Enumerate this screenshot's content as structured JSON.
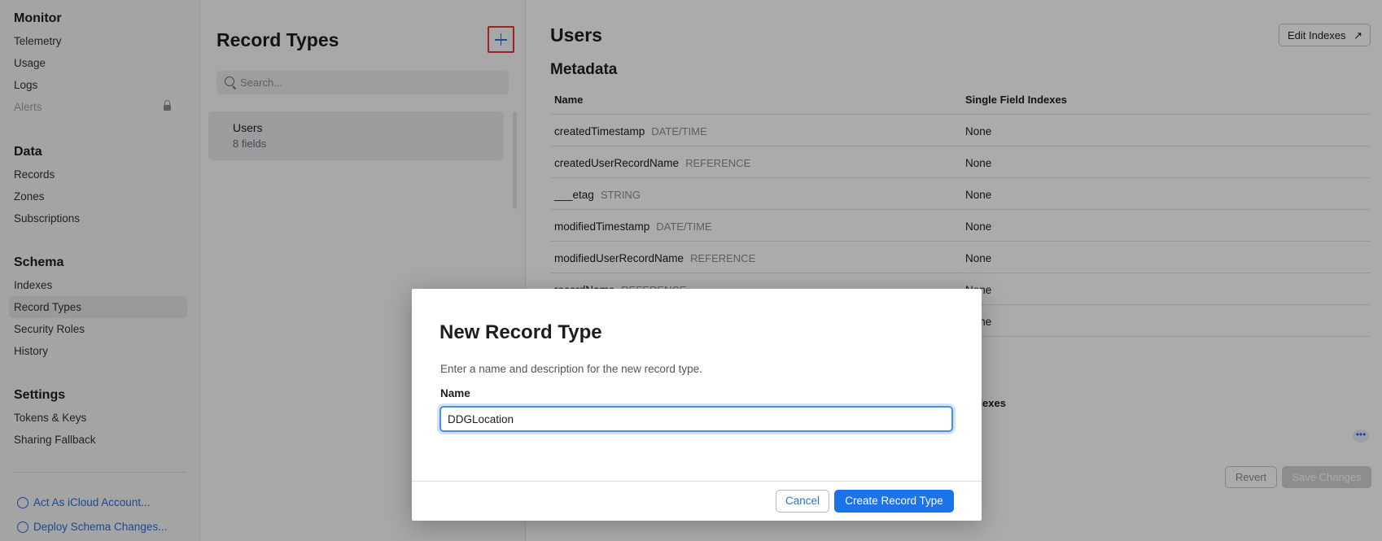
{
  "sidebar": {
    "monitor": {
      "heading": "Monitor",
      "items": [
        {
          "label": "Telemetry"
        },
        {
          "label": "Usage"
        },
        {
          "label": "Logs"
        },
        {
          "label": "Alerts"
        }
      ]
    },
    "data": {
      "heading": "Data",
      "items": [
        {
          "label": "Records"
        },
        {
          "label": "Zones"
        },
        {
          "label": "Subscriptions"
        }
      ]
    },
    "schema": {
      "heading": "Schema",
      "items": [
        {
          "label": "Indexes"
        },
        {
          "label": "Record Types"
        },
        {
          "label": "Security Roles"
        },
        {
          "label": "History"
        }
      ]
    },
    "settings": {
      "heading": "Settings",
      "items": [
        {
          "label": "Tokens & Keys"
        },
        {
          "label": "Sharing Fallback"
        }
      ]
    },
    "actions": {
      "act_as": "Act As iCloud Account...",
      "deploy": "Deploy Schema Changes..."
    }
  },
  "record_types": {
    "title": "Record Types",
    "search_placeholder": "Search...",
    "items": [
      {
        "name": "Users",
        "fields": "8 fields"
      }
    ]
  },
  "main": {
    "title": "Users",
    "edit_indexes": "Edit Indexes",
    "metadata_title": "Metadata",
    "columns": {
      "name": "Name",
      "single_field_indexes": "Single Field Indexes"
    },
    "rows": [
      {
        "name": "createdTimestamp",
        "type": "DATE/TIME",
        "indexes": "None"
      },
      {
        "name": "createdUserRecordName",
        "type": "REFERENCE",
        "indexes": "None"
      },
      {
        "name": "___etag",
        "type": "STRING",
        "indexes": "None"
      },
      {
        "name": "modifiedTimestamp",
        "type": "DATE/TIME",
        "indexes": "None"
      },
      {
        "name": "modifiedUserRecordName",
        "type": "REFERENCE",
        "indexes": "None"
      },
      {
        "name": "recordName",
        "type": "REFERENCE",
        "indexes": "None"
      },
      {
        "name": "",
        "type": "",
        "indexes": "None"
      }
    ],
    "indexes_column_partial": "d Indexes",
    "more": "•••",
    "revert": "Revert",
    "save": "Save Changes"
  },
  "modal": {
    "title": "New Record Type",
    "description": "Enter a name and description for the new record type.",
    "name_label": "Name",
    "name_value": "DDGLocation",
    "cancel": "Cancel",
    "create": "Create Record Type"
  },
  "colors": {
    "accent": "#1a73e8",
    "highlight_border": "#e5353a"
  }
}
